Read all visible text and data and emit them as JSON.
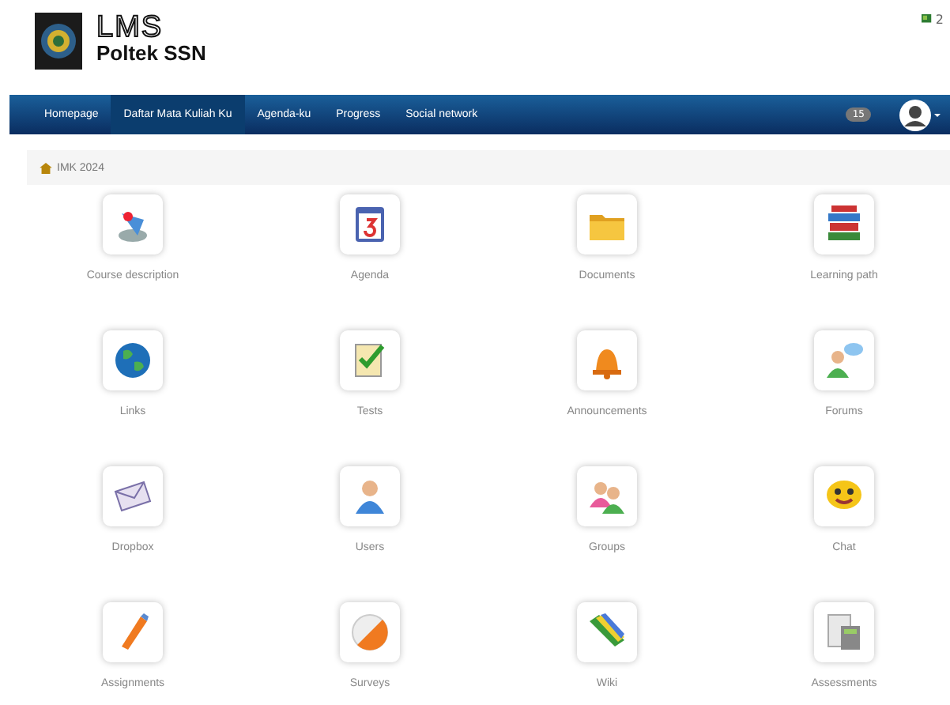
{
  "header": {
    "logo_title": "LMS",
    "logo_subtitle": "Poltek SSN",
    "notification_count": "2"
  },
  "nav": {
    "items": [
      {
        "label": "Homepage",
        "selected": false
      },
      {
        "label": "Daftar Mata Kuliah Ku",
        "selected": true
      },
      {
        "label": "Agenda-ku",
        "selected": false
      },
      {
        "label": "Progress",
        "selected": false
      },
      {
        "label": "Social network",
        "selected": false
      }
    ],
    "badge": "15"
  },
  "breadcrumb": {
    "label": "IMK 2024"
  },
  "tools": [
    {
      "label": "Course description",
      "kind": "description"
    },
    {
      "label": "Agenda",
      "kind": "calendar"
    },
    {
      "label": "Documents",
      "kind": "folder"
    },
    {
      "label": "Learning path",
      "kind": "books"
    },
    {
      "label": "Links",
      "kind": "globe"
    },
    {
      "label": "Tests",
      "kind": "checklist"
    },
    {
      "label": "Announcements",
      "kind": "bell"
    },
    {
      "label": "Forums",
      "kind": "person-bubble"
    },
    {
      "label": "Dropbox",
      "kind": "envelope"
    },
    {
      "label": "Users",
      "kind": "person"
    },
    {
      "label": "Groups",
      "kind": "people"
    },
    {
      "label": "Chat",
      "kind": "smiley"
    },
    {
      "label": "Assignments",
      "kind": "pen"
    },
    {
      "label": "Surveys",
      "kind": "pie"
    },
    {
      "label": "Wiki",
      "kind": "pencils"
    },
    {
      "label": "Assessments",
      "kind": "calculator"
    }
  ]
}
